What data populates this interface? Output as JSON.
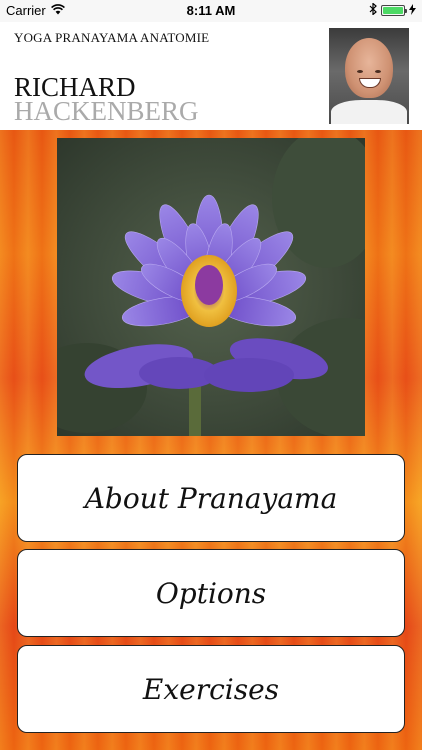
{
  "status_bar": {
    "carrier": "Carrier",
    "time": "8:11 AM",
    "battery_color": "#4cd964"
  },
  "header": {
    "subtitle": "YOGA PRANAYAMA ANATOMIE",
    "name_first": "RICHARD",
    "name_last": "HACKENBERG"
  },
  "menu": {
    "about_label": "About Pranayama",
    "options_label": "Options",
    "exercises_label": "Exercises"
  },
  "colors": {
    "background_orange": "#e85a14",
    "name_gray": "#aaaaaa"
  },
  "icons": {
    "wifi": "wifi-icon",
    "bluetooth": "bluetooth-icon",
    "battery": "battery-icon",
    "charging": "charging-bolt-icon"
  }
}
